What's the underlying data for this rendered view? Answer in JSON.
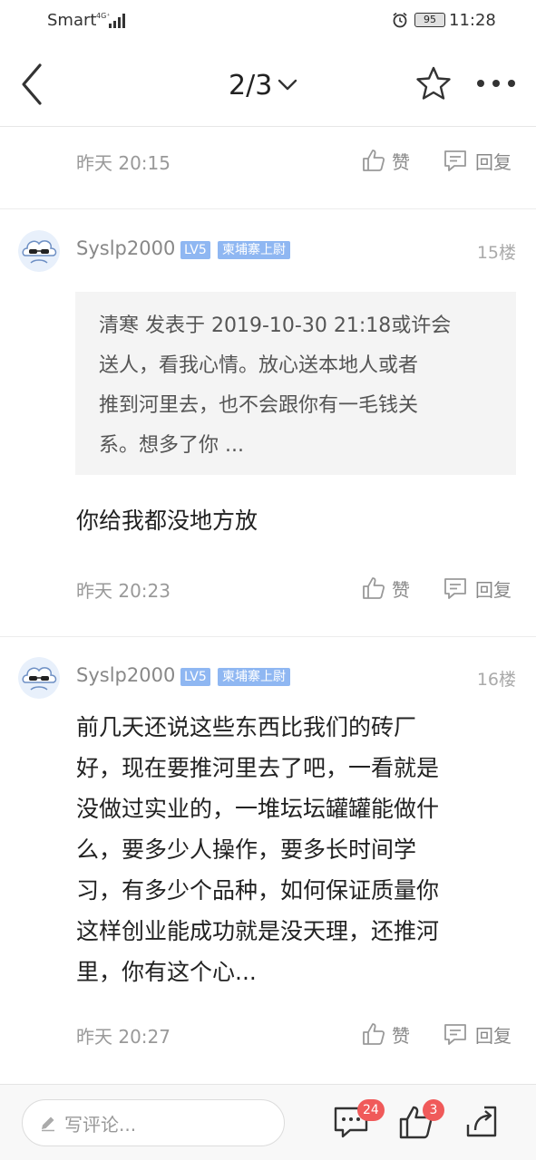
{
  "status_bar": {
    "carrier": "Smart",
    "signal_label": "4G⁺",
    "battery": "95",
    "time": "11:28"
  },
  "header": {
    "pager": "2/3"
  },
  "replies": [
    {
      "time": "昨天 20:15",
      "like_label": "赞",
      "reply_label": "回复"
    }
  ],
  "posts": [
    {
      "username": "Syslp2000",
      "level": "LV5",
      "title_badge": "柬埔寨上尉",
      "floor": "15楼",
      "quote_lines": [
        "清寒 发表于 2019-10-30 21:18或许会",
        "送人，看我心情。放心送本地人或者",
        "推到河里去，也不会跟你有一毛钱关",
        "系。想多了你 ..."
      ],
      "body_lines": [
        "你给我都没地方放"
      ],
      "time": "昨天 20:23",
      "like_label": "赞",
      "reply_label": "回复"
    },
    {
      "username": "Syslp2000",
      "level": "LV5",
      "title_badge": "柬埔寨上尉",
      "floor": "16楼",
      "body_lines": [
        "前几天还说这些东西比我们的砖厂",
        "好，现在要推河里去了吧，一看就是",
        "没做过实业的，一堆坛坛罐罐能做什",
        "么，要多少人操作，要多长时间学",
        "习，有多少个品种，如何保证质量你",
        "这样创业能成功就是没天理，还推河",
        "里，你有这个心..."
      ],
      "time": "昨天 20:27",
      "like_label": "赞",
      "reply_label": "回复"
    }
  ],
  "bottom_bar": {
    "comment_placeholder": "写评论...",
    "comment_count": "24",
    "like_count": "3"
  },
  "colors": {
    "badge_blue": "#8fb7f2",
    "notification_red": "#f05a5a",
    "quote_bg": "#f4f4f4"
  },
  "icons": [
    "back-icon",
    "chevron-down-icon",
    "star-icon",
    "more-icon",
    "thumbs-up-icon",
    "comment-icon",
    "pencil-icon",
    "share-icon",
    "alarm-icon",
    "signal-icon",
    "battery-icon"
  ]
}
